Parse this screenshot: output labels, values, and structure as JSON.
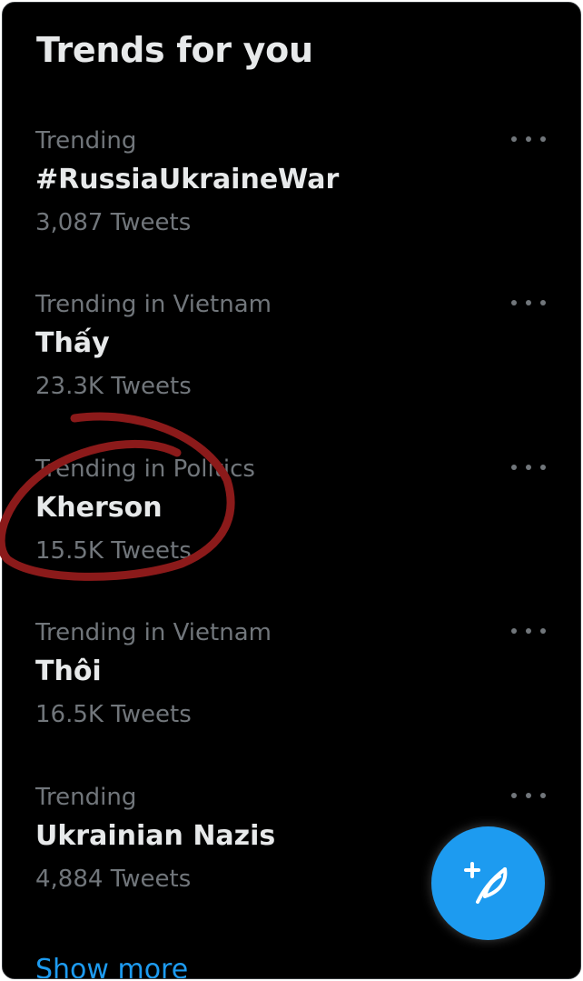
{
  "header": {
    "title": "Trends for you"
  },
  "trends": [
    {
      "context": "Trending",
      "name": "#RussiaUkraineWar",
      "count": "3,087 Tweets"
    },
    {
      "context": "Trending in Vietnam",
      "name": "Thấy",
      "count": "23.3K Tweets"
    },
    {
      "context": "Trending in Politics",
      "name": "Kherson",
      "count": "15.5K Tweets"
    },
    {
      "context": "Trending in Vietnam",
      "name": "Thôi",
      "count": "16.5K Tweets"
    },
    {
      "context": "Trending",
      "name": "Ukrainian Nazis",
      "count": "4,884 Tweets"
    }
  ],
  "footer": {
    "show_more": "Show more"
  },
  "icons": {
    "more": "more-dots-icon",
    "compose": "compose-tweet-icon"
  },
  "colors": {
    "background": "#000000",
    "primary_text": "#e7e9ea",
    "secondary_text": "#71767b",
    "accent": "#1d9bf0",
    "annotation": "#8b1a1a"
  }
}
